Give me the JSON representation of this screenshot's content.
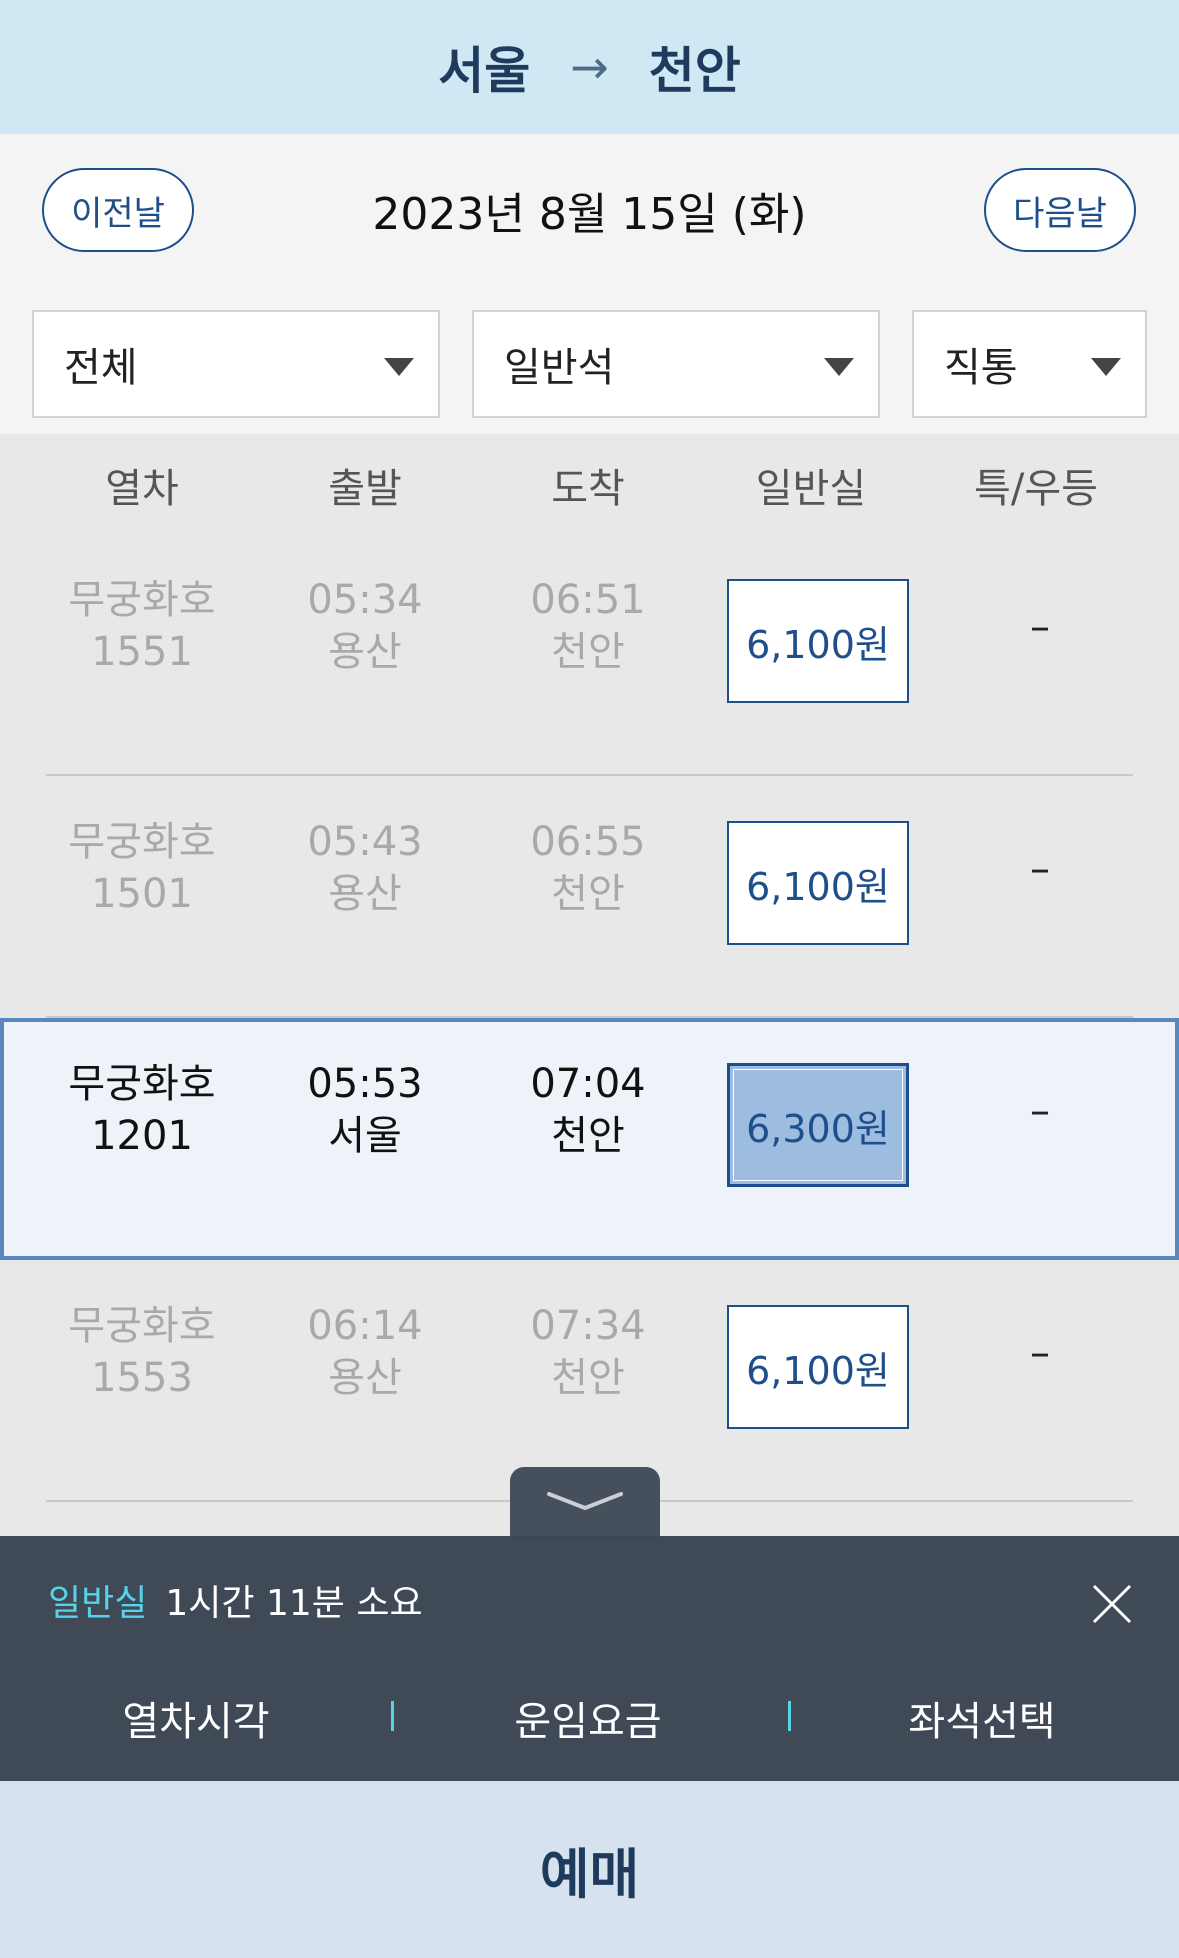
{
  "route": {
    "from": "서울",
    "to": "천안",
    "arrow": "→"
  },
  "date_bar": {
    "prev_label": "이전날",
    "date": "2023년 8월 15일 (화)",
    "next_label": "다음날"
  },
  "filters": [
    {
      "value": "전체"
    },
    {
      "value": "일반석"
    },
    {
      "value": "직통"
    }
  ],
  "columns": [
    "열차",
    "출발",
    "도착",
    "일반실",
    "특/우등"
  ],
  "trains": [
    {
      "name": "무궁화호",
      "number": "1551",
      "dep_time": "05:34",
      "dep_station": "용산",
      "arr_time": "06:51",
      "arr_station": "천안",
      "fare": "6,100원",
      "special": "–",
      "selected": false
    },
    {
      "name": "무궁화호",
      "number": "1501",
      "dep_time": "05:43",
      "dep_station": "용산",
      "arr_time": "06:55",
      "arr_station": "천안",
      "fare": "6,100원",
      "special": "–",
      "selected": false
    },
    {
      "name": "무궁화호",
      "number": "1201",
      "dep_time": "05:53",
      "dep_station": "서울",
      "arr_time": "07:04",
      "arr_station": "천안",
      "fare": "6,300원",
      "special": "–",
      "selected": true
    },
    {
      "name": "무궁화호",
      "number": "1553",
      "dep_time": "06:14",
      "dep_station": "용산",
      "arr_time": "07:34",
      "arr_station": "천안",
      "fare": "6,100원",
      "special": "–",
      "selected": false
    }
  ],
  "detail_panel": {
    "class_label": "일반실",
    "duration": "1시간 11분 소요",
    "tabs": [
      "열차시각",
      "운임요금",
      "좌석선택"
    ]
  },
  "book_button": "예매",
  "icons": {
    "collapse": "chevron-down-icon",
    "close": "close-icon"
  },
  "colors": {
    "header_bg": "#cfe8f3",
    "accent": "#1f4f8a",
    "panel_bg": "#3a4452",
    "highlight": "#56d3e8"
  }
}
